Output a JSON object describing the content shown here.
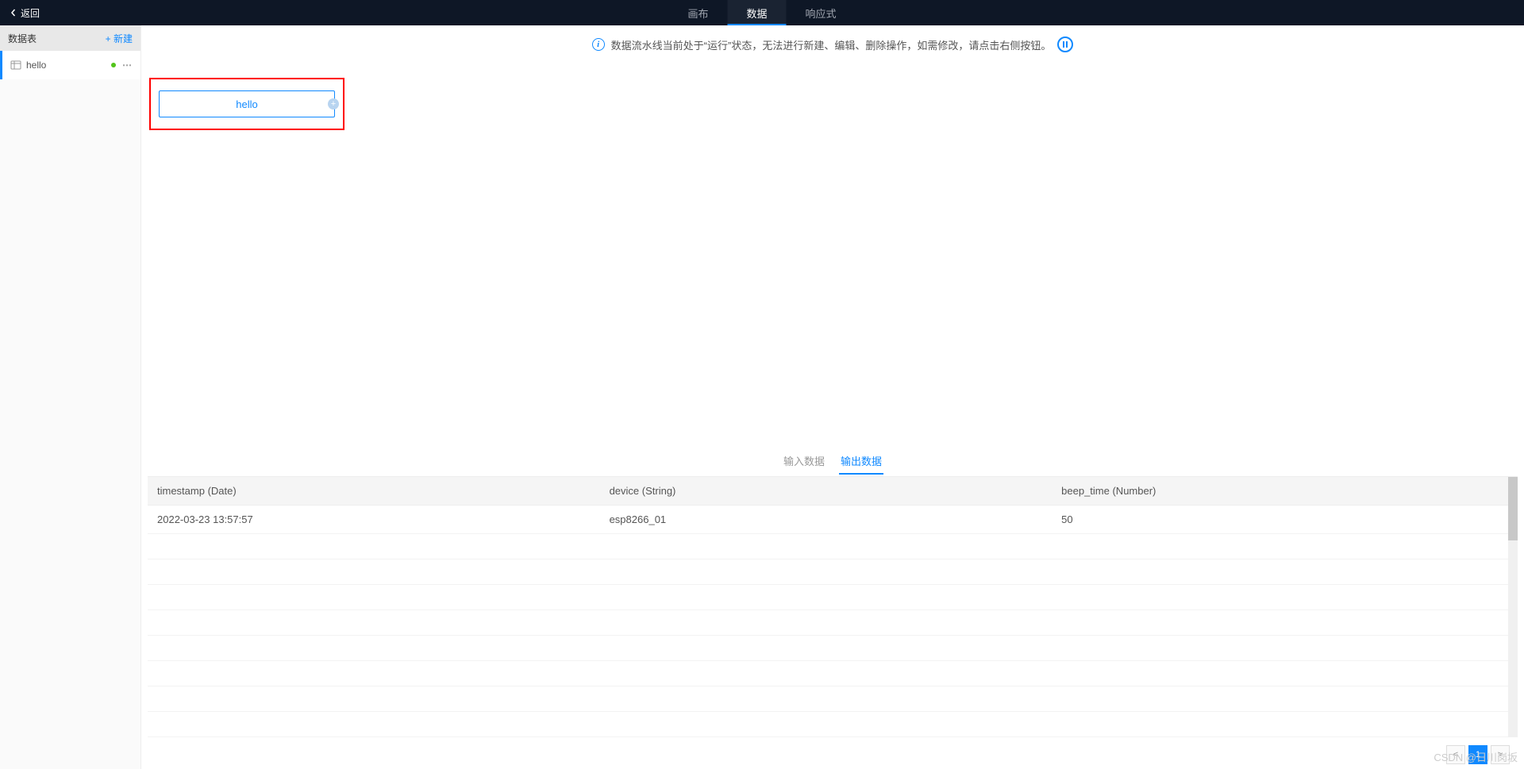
{
  "topbar": {
    "back_label": "返回",
    "tabs": [
      {
        "label": "画布"
      },
      {
        "label": "数据"
      },
      {
        "label": "响应式"
      }
    ]
  },
  "sidebar": {
    "title": "数据表",
    "new_label": "+ 新建",
    "items": [
      {
        "label": "hello"
      }
    ]
  },
  "info_bar": {
    "text": "数据流水线当前处于“运行”状态，无法进行新建、编辑、删除操作，如需修改，请点击右侧按钮。"
  },
  "card": {
    "label": "hello",
    "add_label": "+"
  },
  "sub_tabs": [
    {
      "label": "输入数据"
    },
    {
      "label": "输出数据"
    }
  ],
  "table": {
    "columns": [
      "timestamp (Date)",
      "device (String)",
      "beep_time (Number)"
    ],
    "rows": [
      {
        "c0": "2022-03-23 13:57:57",
        "c1": "esp8266_01",
        "c2": "50"
      }
    ]
  },
  "pagination": {
    "prev": "<",
    "page1": "1",
    "next": ">"
  },
  "watermark": "CSDN @日川岗坂"
}
